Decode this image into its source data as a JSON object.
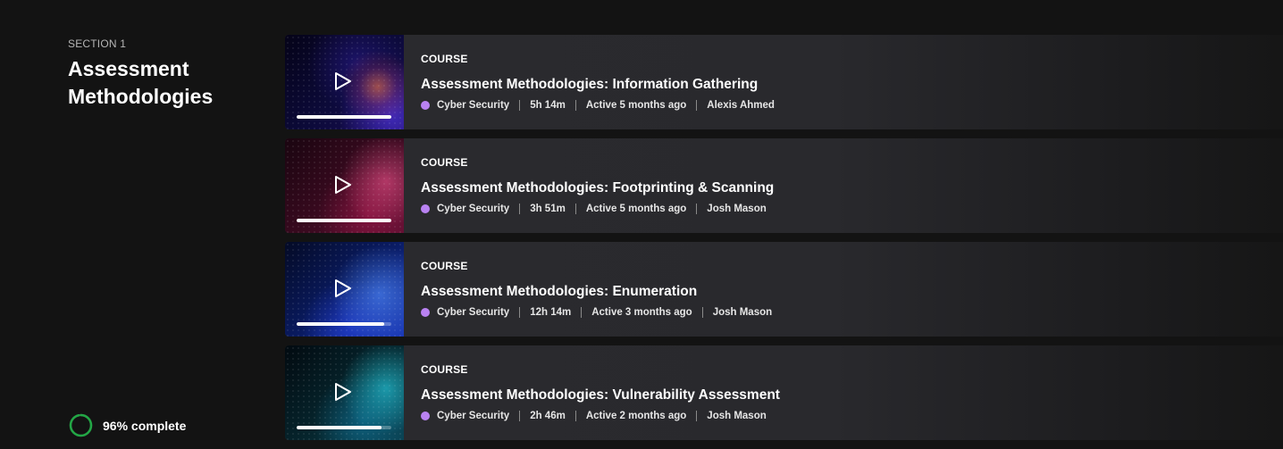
{
  "section": {
    "label": "SECTION 1",
    "title": "Assessment Methodologies"
  },
  "progress": {
    "percent": 96,
    "label": "96% complete",
    "ring_color": "#22a745"
  },
  "colors": {
    "background": "#131313",
    "topic_dot": "#b982f2"
  },
  "courses": [
    {
      "type": "COURSE",
      "title": "Assessment Methodologies: Information Gathering",
      "topic": "Cyber Security",
      "duration": "5h 14m",
      "activity": "Active 5 months ago",
      "author": "Alexis Ahmed",
      "progress": 1.0,
      "thumbnail_icon": "play-icon"
    },
    {
      "type": "COURSE",
      "title": "Assessment Methodologies: Footprinting & Scanning",
      "topic": "Cyber Security",
      "duration": "3h 51m",
      "activity": "Active 5 months ago",
      "author": "Josh Mason",
      "progress": 1.0,
      "thumbnail_icon": "play-icon"
    },
    {
      "type": "COURSE",
      "title": "Assessment Methodologies: Enumeration",
      "topic": "Cyber Security",
      "duration": "12h 14m",
      "activity": "Active 3 months ago",
      "author": "Josh Mason",
      "progress": 0.92,
      "thumbnail_icon": "play-icon"
    },
    {
      "type": "COURSE",
      "title": "Assessment Methodologies: Vulnerability Assessment",
      "topic": "Cyber Security",
      "duration": "2h 46m",
      "activity": "Active 2 months ago",
      "author": "Josh Mason",
      "progress": 0.9,
      "thumbnail_icon": "play-icon"
    }
  ]
}
